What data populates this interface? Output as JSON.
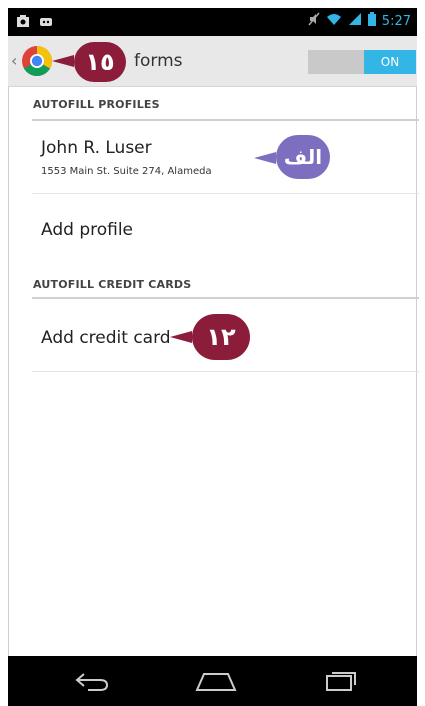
{
  "status_bar": {
    "time": "5:27",
    "left_icons": [
      "screenshot-icon",
      "android-icon"
    ],
    "right_icons": [
      "mute-icon",
      "wifi-icon",
      "signal-icon",
      "battery-icon"
    ],
    "accent": "#33b5e5"
  },
  "action_bar": {
    "title": "forms",
    "toggle_label": "ON",
    "app_icon": "chrome-icon"
  },
  "sections": {
    "profiles_header": "AUTOFILL PROFILES",
    "profile": {
      "name": "John R. Luser",
      "address": "1553 Main St. Suite 274, Alameda"
    },
    "add_profile": "Add profile",
    "cards_header": "AUTOFILL CREDIT CARDS",
    "add_card": "Add credit card"
  },
  "callouts": {
    "c15": "١٥",
    "calef": "الف",
    "c12": "١٢"
  },
  "nav_bar": {
    "icons": [
      "back-icon",
      "home-icon",
      "recents-icon"
    ]
  },
  "colors": {
    "callout_red": "#8b1c3a",
    "callout_purple": "#7e6ec0",
    "toggle_on": "#33b5e5"
  }
}
